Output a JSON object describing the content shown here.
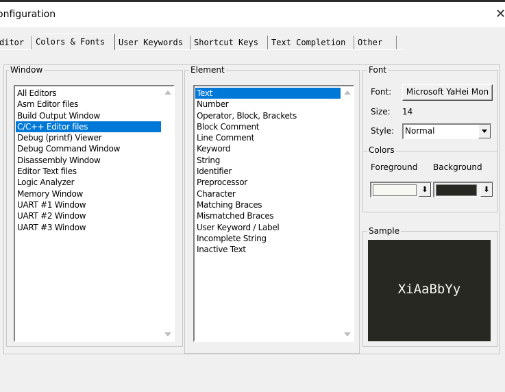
{
  "window": {
    "title": "onfiguration",
    "close_glyph": "✕"
  },
  "tabs": [
    {
      "label": "ditor",
      "active": false
    },
    {
      "label": "Colors & Fonts",
      "active": true
    },
    {
      "label": "User Keywords",
      "active": false
    },
    {
      "label": "Shortcut Keys",
      "active": false
    },
    {
      "label": "Text Completion",
      "active": false
    },
    {
      "label": "Other",
      "active": false
    }
  ],
  "window_group": {
    "legend": "Window",
    "selected_index": 3,
    "items": [
      "All Editors",
      "Asm Editor files",
      "Build Output Window",
      "C/C++ Editor files",
      "Debug (printf) Viewer",
      "Debug Command Window",
      "Disassembly Window",
      "Editor Text files",
      "Logic Analyzer",
      "Memory Window",
      "UART #1 Window",
      "UART #2 Window",
      "UART #3 Window"
    ]
  },
  "element_group": {
    "legend": "Element",
    "selected_index": 0,
    "items": [
      "Text",
      "Number",
      "Operator, Block, Brackets",
      "Block Comment",
      "Line Comment",
      "Keyword",
      "String",
      "Identifier",
      "Preprocessor",
      "Character",
      "Matching Braces",
      "Mismatched Braces",
      "User Keyword / Label",
      "Incomplete String",
      "Inactive Text"
    ]
  },
  "font_group": {
    "legend": "Font",
    "font_label": "Font:",
    "font_button": "Microsoft YaHei Mon",
    "size_label": "Size:",
    "size_value": "14",
    "style_label": "Style:",
    "style_value": "Normal"
  },
  "colors_group": {
    "legend": "Colors",
    "foreground_label": "Foreground",
    "background_label": "Background",
    "foreground_color": "#f8f8f2",
    "background_color": "#272822",
    "picker_glyph": "⬇"
  },
  "sample_group": {
    "legend": "Sample",
    "sample_text": "XiAaBbYy",
    "bg_color": "#272822",
    "fg_color": "#f8f8f2"
  },
  "colors": {
    "selection": "#0078d7",
    "dialog_bg": "#f0f0f0"
  }
}
